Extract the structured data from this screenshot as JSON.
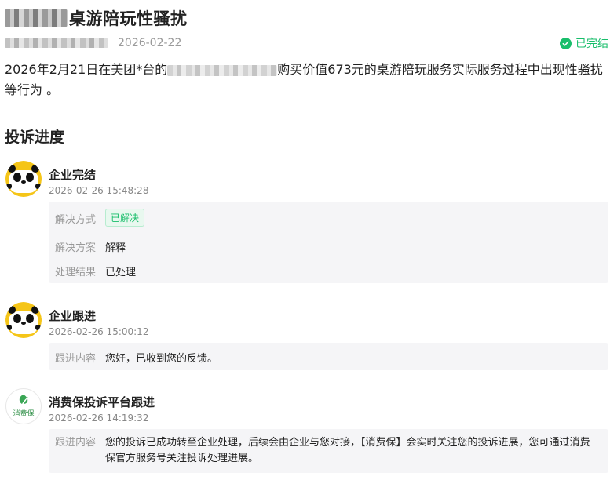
{
  "header": {
    "title": "桌游陪玩性骚扰",
    "date": "2026-02-22",
    "status": "已完结"
  },
  "complaint": {
    "desc_part1": "2026年2月21日在美团*台的",
    "desc_part2": "购买价值673元的桌游陪玩服务实际服务过程中出现性骚扰等行为 。"
  },
  "progress": {
    "title": "投诉进度",
    "events": [
      {
        "title": "企业完结",
        "time": "2026-02-26 15:48:28",
        "rows": [
          {
            "key": "解决方式",
            "value": "已解决"
          },
          {
            "key": "解决方案",
            "value": "解释"
          },
          {
            "key": "处理结果",
            "value": "已处理"
          }
        ]
      },
      {
        "title": "企业跟进",
        "time": "2026-02-26 15:00:12",
        "rows": [
          {
            "key": "跟进内容",
            "value": "您好，已收到您的反馈。"
          }
        ]
      },
      {
        "title": "消费保投诉平台跟进",
        "time": "2026-02-26 14:19:32",
        "logo_text": "消费保",
        "rows": [
          {
            "key": "跟进内容",
            "value": "您的投诉已成功转至企业处理，后续会由企业与您对接，【消费保】会实时关注您的投诉进展，您可通过消费保官方服务号关注投诉处理进展。"
          }
        ]
      }
    ]
  },
  "colors": {
    "accent_green": "#19be6b",
    "panda_yellow": "#f5c518"
  },
  "icons": {
    "status": "check-circle-icon",
    "avatar_company": "panda-avatar-icon",
    "avatar_platform": "xiaofeibao-logo-icon"
  }
}
